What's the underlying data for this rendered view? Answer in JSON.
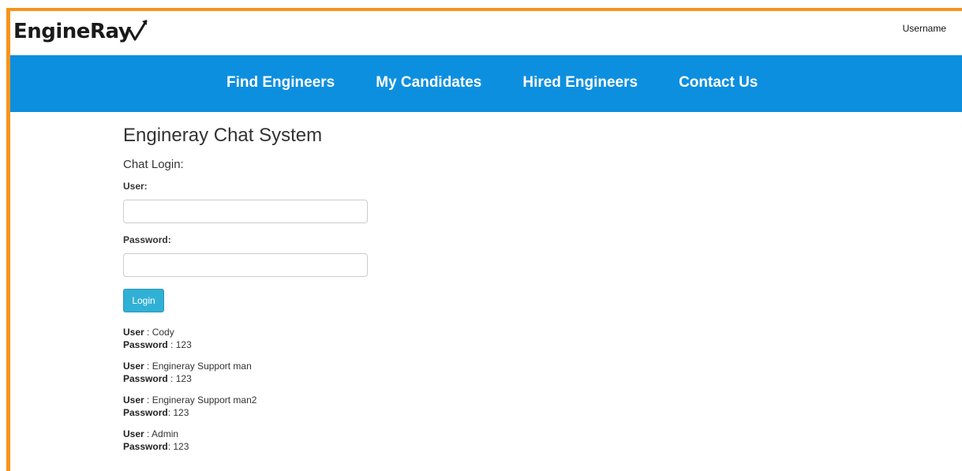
{
  "header": {
    "logo_text": "EngineRay",
    "username": "Username"
  },
  "nav": {
    "items": [
      "Find Engineers",
      "My Candidates",
      "Hired Engineers",
      "Contact Us"
    ]
  },
  "main": {
    "title": "Engineray Chat System",
    "subtitle": "Chat Login:",
    "user_label": "User:",
    "user_value": "",
    "password_label": "Password:",
    "password_value": "",
    "login_button": "Login"
  },
  "credentials": [
    {
      "user_label": "User",
      "user_sep": " : ",
      "user": "Cody",
      "password_label": "Password",
      "password_sep": " : ",
      "password": "123"
    },
    {
      "user_label": "User",
      "user_sep": " : ",
      "user": "Engineray Support man",
      "password_label": "Password",
      "password_sep": " : ",
      "password": "123"
    },
    {
      "user_label": "User",
      "user_sep": " : ",
      "user": "Engineray Support man2",
      "password_label": "Password",
      "password_sep": ": ",
      "password": "123"
    },
    {
      "user_label": "User",
      "user_sep": " : ",
      "user": "Admin",
      "password_label": "Password",
      "password_sep": ": ",
      "password": "123"
    }
  ],
  "colors": {
    "navbar": "#0d8fe0",
    "frame": "#f7941d",
    "button": "#31b0d5"
  }
}
